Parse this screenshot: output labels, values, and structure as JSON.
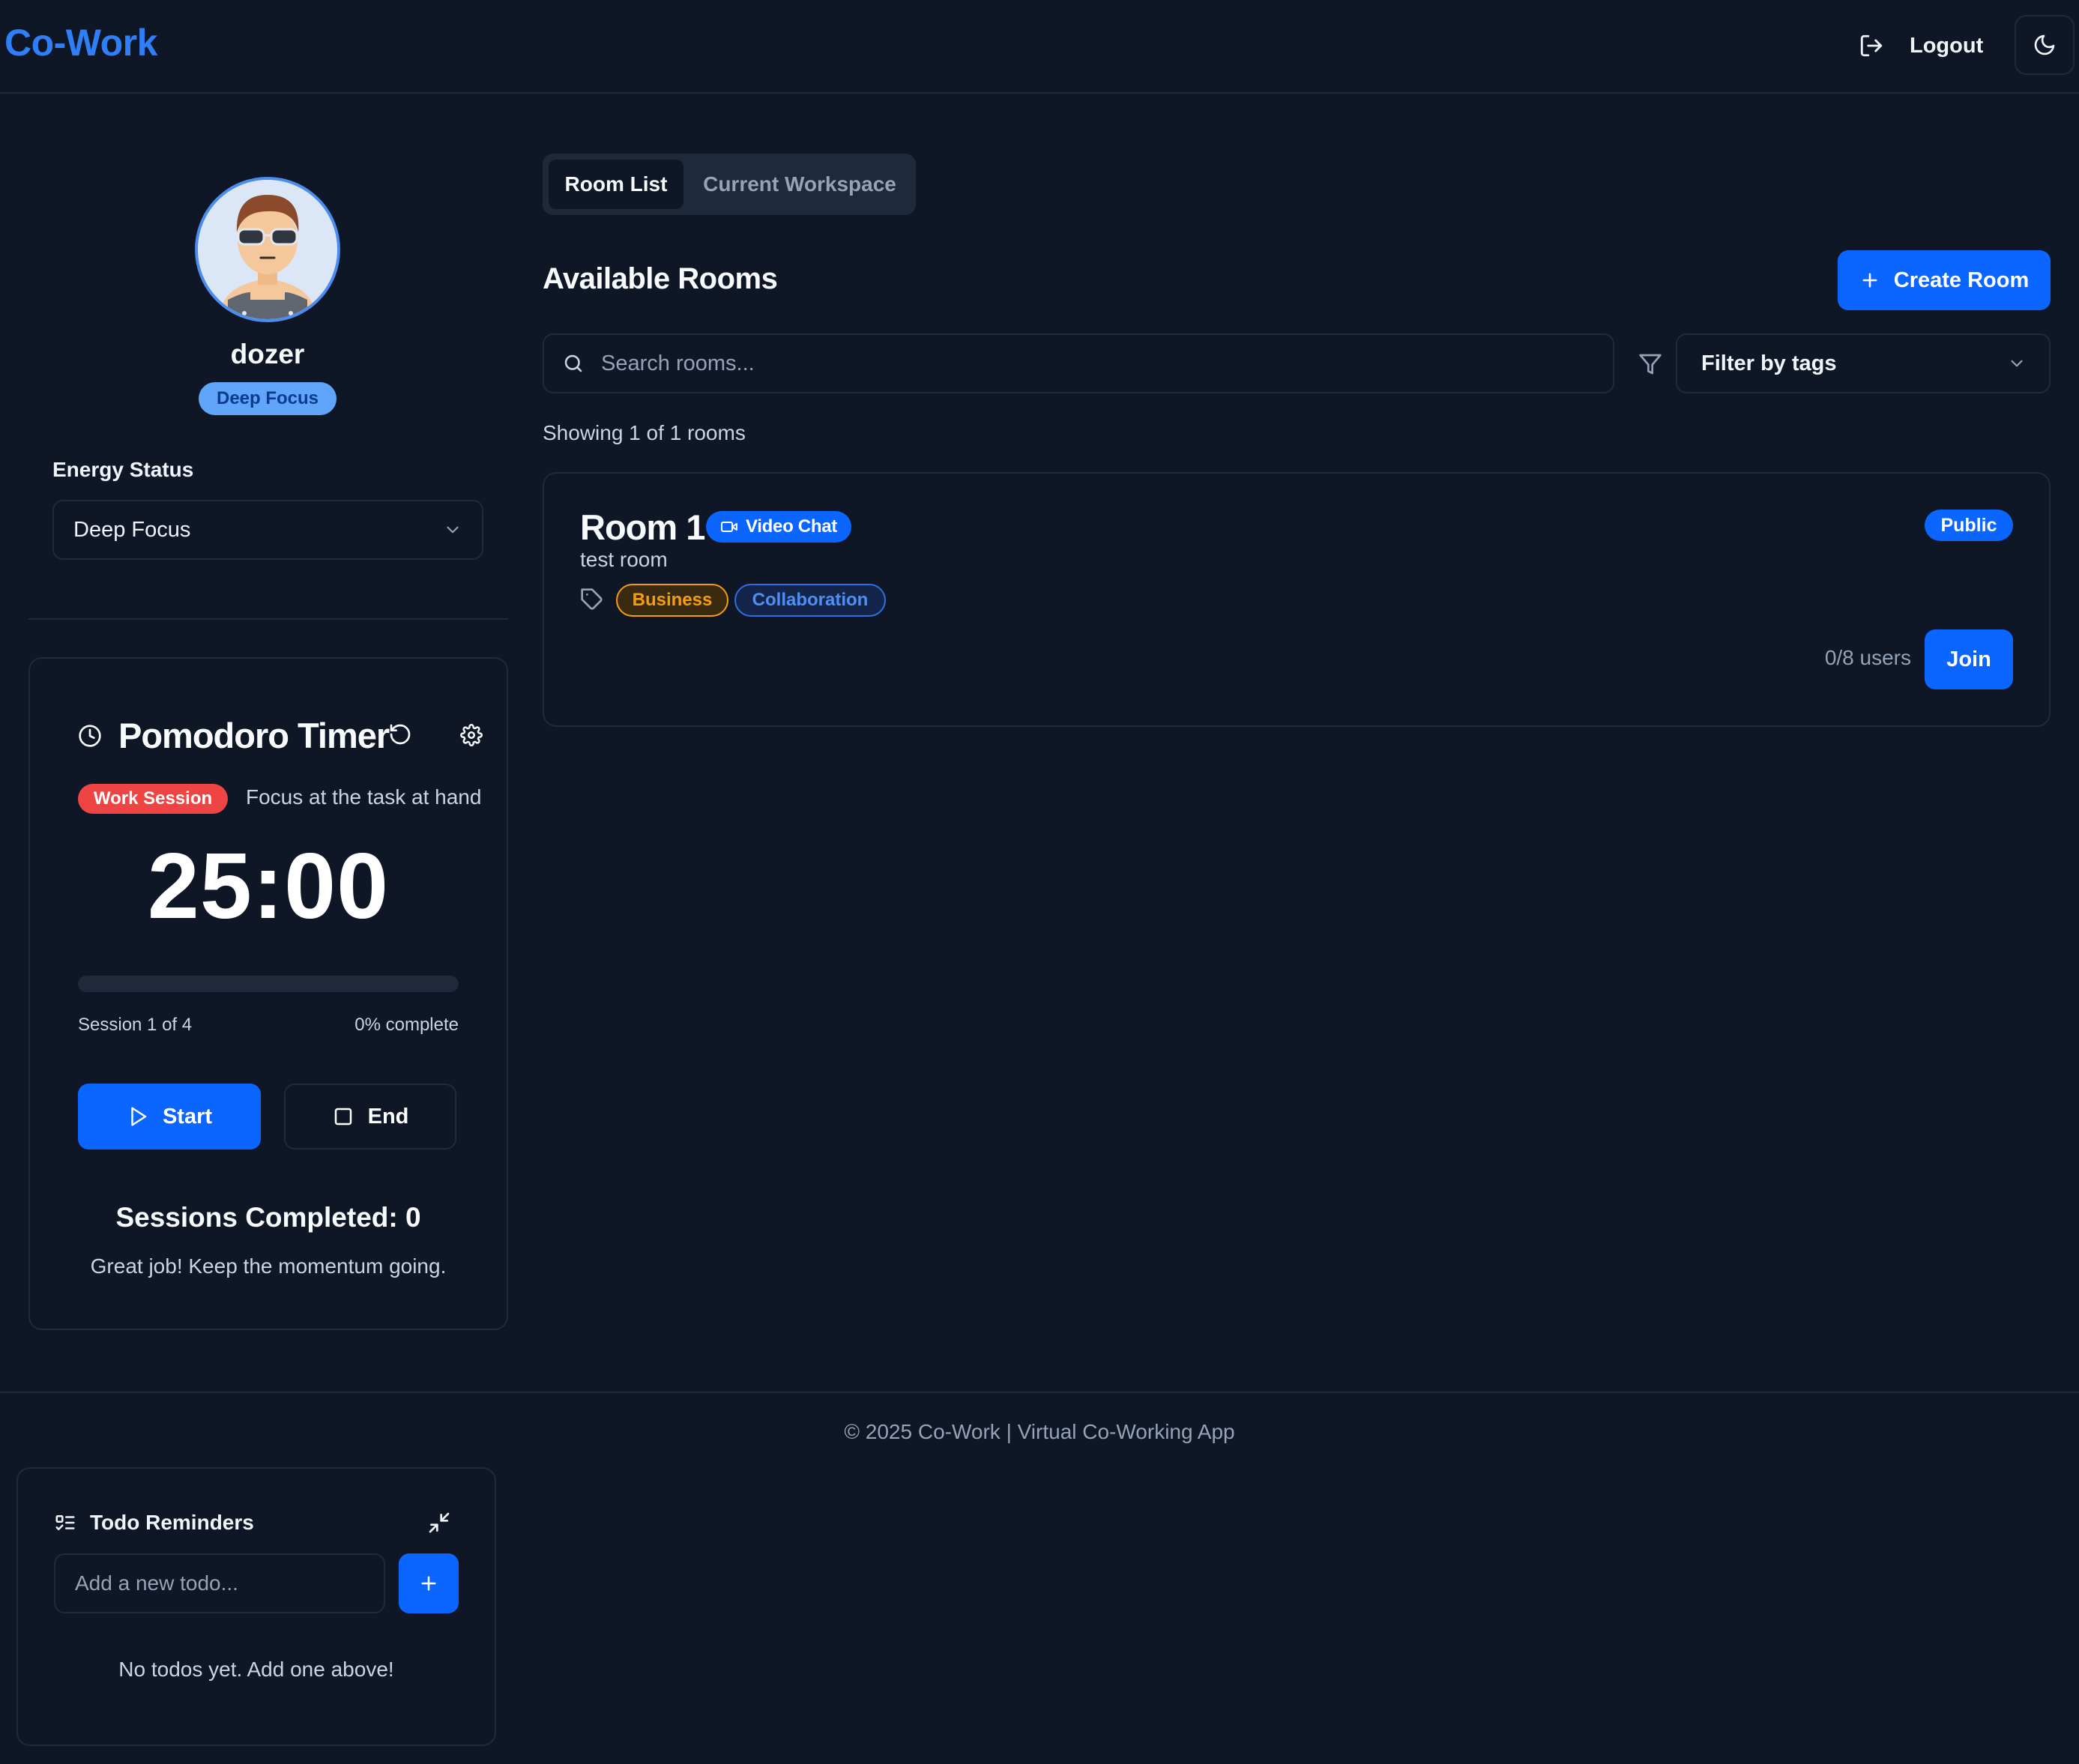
{
  "header": {
    "logo": "Co-Work",
    "logout_label": "Logout",
    "logout_icon": "log-out-icon",
    "theme_icon": "moon-icon"
  },
  "sidebar": {
    "username": "dozer",
    "energy_badge": "Deep Focus",
    "energy_label": "Energy Status",
    "energy_value": "Deep Focus"
  },
  "pomodoro": {
    "title": "Pomodoro Timer",
    "mode_badge": "Work Session",
    "mode_text": "Focus at the task at hand",
    "time": "25:00",
    "progress": 0,
    "session_text": "Session 1 of 4",
    "complete_text": "0% complete",
    "start_label": "Start",
    "end_label": "End",
    "sessions_completed": "Sessions Completed: 0",
    "encouragement": "Great job! Keep the momentum going."
  },
  "main": {
    "tabs": [
      {
        "label": "Room List",
        "active": true
      },
      {
        "label": "Current Workspace",
        "active": false
      }
    ],
    "section_title": "Available Rooms",
    "create_label": "Create Room",
    "search_placeholder": "Search rooms...",
    "filter_label": "Filter by tags",
    "showing": "Showing 1 of 1 rooms",
    "rooms": [
      {
        "name": "Room 1",
        "type_badge": "Video Chat",
        "description": "test room",
        "tags": [
          "Business",
          "Collaboration"
        ],
        "visibility": "Public",
        "users": "0/8 users",
        "join_label": "Join"
      }
    ]
  },
  "footer": {
    "text": "© 2025 Co-Work | Virtual Co-Working App"
  },
  "todo": {
    "title": "Todo Reminders",
    "input_placeholder": "Add a new todo...",
    "empty_text": "No todos yet. Add one above!"
  },
  "colors": {
    "background": "#0f1626",
    "accent": "#0a66ff",
    "logo": "#2f80f8",
    "work_session": "#ef4444",
    "tag_business": "#f59e0b",
    "tag_collaboration": "#4f8ff5"
  }
}
